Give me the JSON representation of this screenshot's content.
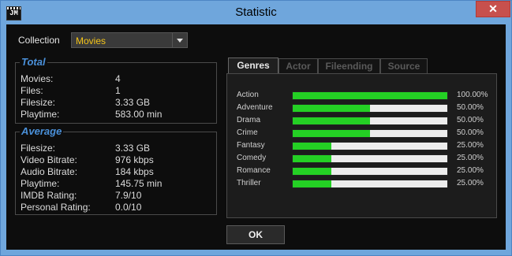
{
  "window": {
    "title": "Statistic",
    "app_icon_text": "JM",
    "close_glyph": "✕"
  },
  "collection": {
    "label": "Collection",
    "value": "Movies"
  },
  "total": {
    "title": "Total",
    "rows": [
      {
        "label": "Movies:",
        "value": "4"
      },
      {
        "label": "Files:",
        "value": "1"
      },
      {
        "label": "Filesize:",
        "value": "3.33 GB"
      },
      {
        "label": "Playtime:",
        "value": "583.00 min"
      }
    ]
  },
  "average": {
    "title": "Average",
    "rows": [
      {
        "label": "Filesize:",
        "value": "3.33 GB"
      },
      {
        "label": "Video Bitrate:",
        "value": "976 kbps"
      },
      {
        "label": "Audio Bitrate:",
        "value": "184 kbps"
      },
      {
        "label": "Playtime:",
        "value": "145.75 min"
      },
      {
        "label": "IMDB Rating:",
        "value": "7.9/10"
      },
      {
        "label": "Personal Rating:",
        "value": "0.0/10"
      }
    ]
  },
  "tabs": [
    {
      "label": "Genres",
      "active": true
    },
    {
      "label": "Actor",
      "active": false
    },
    {
      "label": "Fileending",
      "active": false
    },
    {
      "label": "Source",
      "active": false
    }
  ],
  "genres": [
    {
      "name": "Action",
      "percent": 100,
      "percent_label": "100.00%"
    },
    {
      "name": "Adventure",
      "percent": 50,
      "percent_label": "50.00%"
    },
    {
      "name": "Drama",
      "percent": 50,
      "percent_label": "50.00%"
    },
    {
      "name": "Crime",
      "percent": 50,
      "percent_label": "50.00%"
    },
    {
      "name": "Fantasy",
      "percent": 25,
      "percent_label": "25.00%"
    },
    {
      "name": "Comedy",
      "percent": 25,
      "percent_label": "25.00%"
    },
    {
      "name": "Romance",
      "percent": 25,
      "percent_label": "25.00%"
    },
    {
      "name": "Thriller",
      "percent": 25,
      "percent_label": "25.00%"
    }
  ],
  "buttons": {
    "ok_label": "OK"
  },
  "colors": {
    "accent_title": "#4a90d9",
    "combo_text": "#f5c518",
    "bar_fill": "#24d024",
    "titlebar": "#6fa6dc",
    "close": "#c7504d"
  }
}
